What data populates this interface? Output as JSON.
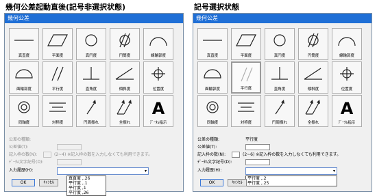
{
  "panels": [
    {
      "caption": "幾何公差起動直後(記号非選択状態)",
      "window_title": "幾何公差",
      "symbols": [
        {
          "label": "真直度",
          "icon": "straightness-icon"
        },
        {
          "label": "平面度",
          "icon": "flatness-icon"
        },
        {
          "label": "真円度",
          "icon": "circularity-icon"
        },
        {
          "label": "円筒度",
          "icon": "cylindricity-icon"
        },
        {
          "label": "線輪郭度",
          "icon": "line-profile-icon"
        },
        {
          "label": "面輪郭度",
          "icon": "surface-profile-icon"
        },
        {
          "label": "平行度",
          "icon": "parallelism-icon"
        },
        {
          "label": "直角度",
          "icon": "perpendicularity-icon"
        },
        {
          "label": "傾斜度",
          "icon": "angularity-icon"
        },
        {
          "label": "位置度",
          "icon": "position-icon"
        },
        {
          "label": "同軸度",
          "icon": "concentricity-icon"
        },
        {
          "label": "対称度",
          "icon": "symmetry-icon"
        },
        {
          "label": "円周振れ",
          "icon": "circular-runout-icon"
        },
        {
          "label": "全振れ",
          "icon": "total-runout-icon"
        },
        {
          "label": "ﾃﾞｰﾀﾑ指示",
          "icon": "datum-indicator-icon"
        }
      ],
      "form": {
        "type_label": "公差の種類:",
        "type_value": "",
        "tolerance_label": "公差値(T):",
        "tolerance_value": "",
        "frame_count_label": "記入枠の数(N):",
        "frame_count_value": "",
        "frame_count_note": "(2~4) ※記入枠の数を入力しなくても利用できます。",
        "datum_label": "ﾃﾞｰﾀﾑ文字記号(D):",
        "datum_value": "",
        "history_label": "入力履歴(H):",
        "history_value": "",
        "history_options": [
          "真直度 ,.26",
          "平行度 ,.1",
          "平行度 ,1",
          "平行度 ,26"
        ],
        "ok_label": "OK",
        "cancel_label": "ｷｬﾝｾﾙ"
      }
    },
    {
      "caption": "記号選択状態",
      "window_title": "幾何公差",
      "symbols": [
        {
          "label": "真直度",
          "icon": "straightness-icon"
        },
        {
          "label": "平面度",
          "icon": "flatness-icon"
        },
        {
          "label": "真円度",
          "icon": "circularity-icon"
        },
        {
          "label": "円筒度",
          "icon": "cylindricity-icon"
        },
        {
          "label": "線輪郭度",
          "icon": "line-profile-icon"
        },
        {
          "label": "面輪郭度",
          "icon": "surface-profile-icon"
        },
        {
          "label": "平行度",
          "icon": "parallelism-icon"
        },
        {
          "label": "直角度",
          "icon": "perpendicularity-icon"
        },
        {
          "label": "傾斜度",
          "icon": "angularity-icon"
        },
        {
          "label": "位置度",
          "icon": "position-icon"
        },
        {
          "label": "同軸度",
          "icon": "concentricity-icon"
        },
        {
          "label": "対称度",
          "icon": "symmetry-icon"
        },
        {
          "label": "円周振れ",
          "icon": "circular-runout-icon"
        },
        {
          "label": "全振れ",
          "icon": "total-runout-icon"
        },
        {
          "label": "ﾃﾞｰﾀﾑ指示",
          "icon": "datum-indicator-icon"
        }
      ],
      "selected_symbol": "平行度",
      "form": {
        "type_label": "公差の種類:",
        "type_value": "平行度",
        "tolerance_label": "公差値(T):",
        "tolerance_value": "",
        "frame_count_label": "記入枠の数(N):",
        "frame_count_value": "",
        "frame_count_note": "(2~6) ※記入枠の数を入力しなくても利用できます。",
        "datum_label": "ﾃﾞｰﾀﾑ文字記号(D):",
        "datum_value": "",
        "history_label": "入力履歴(H):",
        "history_value": "",
        "history_options": [
          "平行度 ,.2",
          "平行度 ,.25"
        ],
        "ok_label": "OK",
        "cancel_label": "ｷｬﾝｾﾙ"
      }
    }
  ]
}
